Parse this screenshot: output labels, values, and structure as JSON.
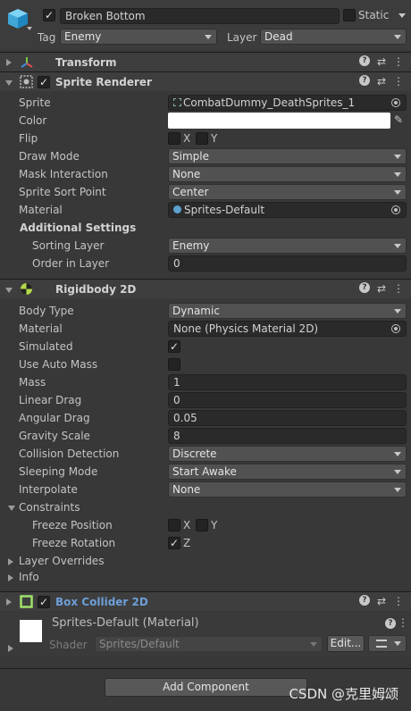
{
  "header": {
    "object_name": "Broken Bottom",
    "static_label": "Static",
    "tag_label": "Tag",
    "tag_value": "Enemy",
    "layer_label": "Layer",
    "layer_value": "Dead"
  },
  "transform": {
    "title": "Transform"
  },
  "sprite_renderer": {
    "title": "Sprite Renderer",
    "rows": {
      "sprite": {
        "label": "Sprite",
        "value": "CombatDummy_DeathSprites_1"
      },
      "color": {
        "label": "Color",
        "value_hex": "#ffffff"
      },
      "flip": {
        "label": "Flip",
        "x": "X",
        "y": "Y"
      },
      "draw_mode": {
        "label": "Draw Mode",
        "value": "Simple"
      },
      "mask_interaction": {
        "label": "Mask Interaction",
        "value": "None"
      },
      "sprite_sort_point": {
        "label": "Sprite Sort Point",
        "value": "Center"
      },
      "material": {
        "label": "Material",
        "value": "Sprites-Default"
      }
    },
    "additional_settings": {
      "title": "Additional Settings",
      "sorting_layer": {
        "label": "Sorting Layer",
        "value": "Enemy"
      },
      "order_in_layer": {
        "label": "Order in Layer",
        "value": "0"
      }
    }
  },
  "rigidbody": {
    "title": "Rigidbody 2D",
    "body_type": {
      "label": "Body Type",
      "value": "Dynamic"
    },
    "material": {
      "label": "Material",
      "value": "None (Physics Material 2D)"
    },
    "simulated": {
      "label": "Simulated",
      "checked": true
    },
    "use_auto_mass": {
      "label": "Use Auto Mass",
      "checked": false
    },
    "mass": {
      "label": "Mass",
      "value": "1"
    },
    "linear_drag": {
      "label": "Linear Drag",
      "value": "0"
    },
    "angular_drag": {
      "label": "Angular Drag",
      "value": "0.05"
    },
    "gravity_scale": {
      "label": "Gravity Scale",
      "value": "8"
    },
    "collision_detection": {
      "label": "Collision Detection",
      "value": "Discrete"
    },
    "sleeping_mode": {
      "label": "Sleeping Mode",
      "value": "Start Awake"
    },
    "interpolate": {
      "label": "Interpolate",
      "value": "None"
    },
    "constraints": {
      "title": "Constraints",
      "freeze_position": {
        "label": "Freeze Position",
        "x": "X",
        "y": "Y"
      },
      "freeze_rotation": {
        "label": "Freeze Rotation",
        "z": "Z"
      }
    },
    "layer_overrides": "Layer Overrides",
    "info": "Info"
  },
  "box_collider": {
    "title": "Box Collider 2D"
  },
  "material_preview": {
    "name": "Sprites-Default (Material)",
    "shader_label": "Shader",
    "shader_value": "Sprites/Default",
    "edit_label": "Edit..."
  },
  "add_component_label": "Add Component",
  "watermark": "CSDN @克里姆颂",
  "colors": {
    "bg": "#383838",
    "collider_title": "#6d9fd8",
    "field": "#2a2a2a"
  }
}
